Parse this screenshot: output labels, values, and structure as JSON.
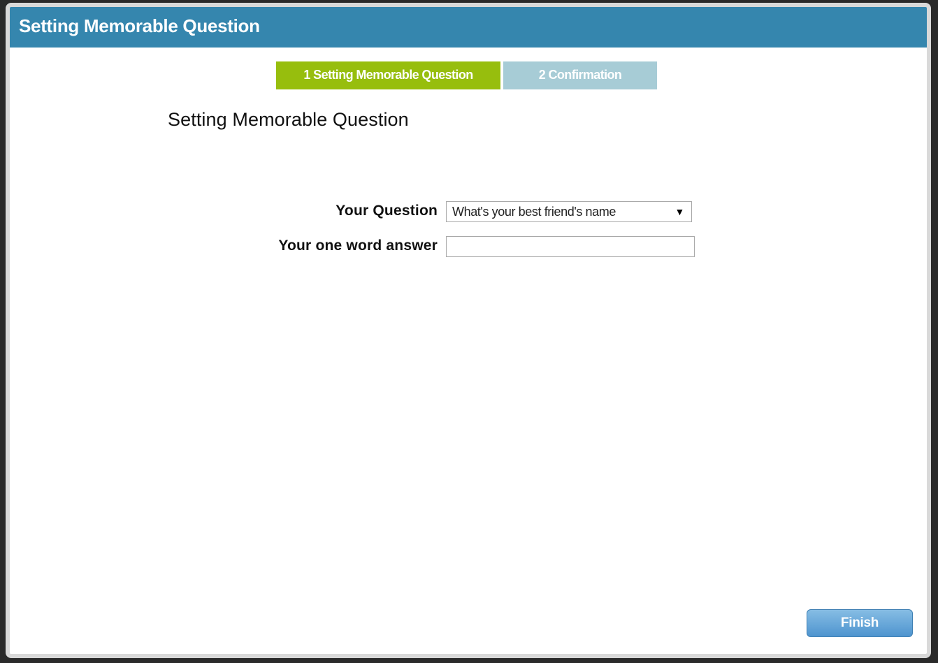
{
  "window": {
    "title": "Setting Memorable Question"
  },
  "steps": [
    {
      "label": "1 Setting Memorable Question",
      "state": "active",
      "color": "#97be0d"
    },
    {
      "label": "2 Confirmation",
      "state": "inactive",
      "color": "#a7ccd6"
    }
  ],
  "main": {
    "heading": "Setting Memorable Question"
  },
  "form": {
    "question_label": "Your Question",
    "question_selected": "What's your best friend's name",
    "answer_label": "Your one word answer",
    "answer_value": "",
    "answer_placeholder": ""
  },
  "actions": {
    "finish_label": "Finish"
  },
  "colors": {
    "titlebar": "#3586ae",
    "step_active": "#97be0d",
    "step_inactive": "#a7ccd6",
    "button": "#5a9fd6"
  },
  "icons": {
    "dropdown": "chevron-down-icon"
  }
}
